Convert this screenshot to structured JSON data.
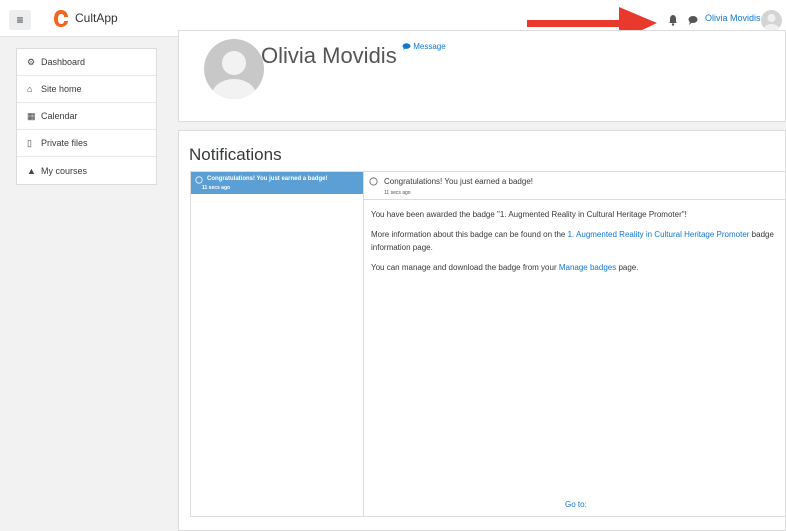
{
  "navbar": {
    "menu_glyph": "≡",
    "brand": "CultApp",
    "user_name": "Olivia Movidis",
    "brand_color": "#f26522"
  },
  "sidebar": {
    "items": [
      {
        "label": "Dashboard",
        "icon": "dashboard-icon",
        "glyph": "⚙"
      },
      {
        "label": "Site home",
        "icon": "home-icon",
        "glyph": "⌂"
      },
      {
        "label": "Calendar",
        "icon": "calendar-icon",
        "glyph": "▦"
      },
      {
        "label": "Private files",
        "icon": "file-icon",
        "glyph": "▯"
      },
      {
        "label": "My courses",
        "icon": "graduation-cap-icon",
        "glyph": "▲"
      }
    ]
  },
  "header": {
    "name": "Olivia Movidis",
    "message_label": "Message"
  },
  "notifications": {
    "title": "Notifications",
    "list": [
      {
        "subject": "Congratulations! You just earned a badge!",
        "time": "11 secs ago"
      }
    ],
    "detail": {
      "subject": "Congratulations! You just earned a badge!",
      "time": "11 secs ago",
      "para1": "You have been awarded the badge \"1. Augmented Reality in Cultural Heritage Promoter\"!",
      "para2_prefix": "More information about this badge can be found on the ",
      "para2_link": "1. Augmented Reality in Cultural Heritage Promoter",
      "para2_suffix": " badge information page.",
      "para3_prefix": "You can manage and download the badge from your ",
      "para3_link": "Manage badges",
      "para3_suffix": " page.",
      "goto_label": "Go to:"
    }
  },
  "colors": {
    "link": "#1177d1",
    "selected": "#5b9fd4",
    "arrow": "#e8392c"
  }
}
